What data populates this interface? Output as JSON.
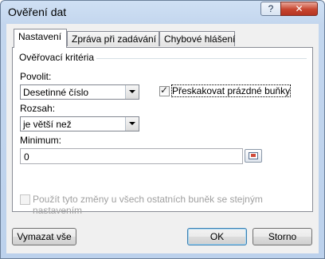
{
  "window": {
    "title": "Ověření dat",
    "help_label": "?",
    "close_label": "✕"
  },
  "tabs": [
    {
      "label": "Nastavení",
      "active": true
    },
    {
      "label": "Zpráva při zadávání",
      "active": false
    },
    {
      "label": "Chybové hlášení",
      "active": false
    }
  ],
  "settings": {
    "group_title": "Ověřovací kritéria",
    "allow_label": "Povolit:",
    "allow_value": "Desetinné číslo",
    "ignore_blank_label": "Přeskakovat prázdné buňky",
    "ignore_blank_checked": true,
    "data_label": "Rozsah:",
    "data_value": "je větší než",
    "minimum_label": "Minimum:",
    "minimum_value": "0",
    "apply_all_label": "Použít tyto změny u všech ostatních buněk se stejným nastavením",
    "apply_all_checked": false
  },
  "buttons": {
    "clear_all": "Vymazat vše",
    "ok": "OK",
    "cancel": "Storno"
  }
}
